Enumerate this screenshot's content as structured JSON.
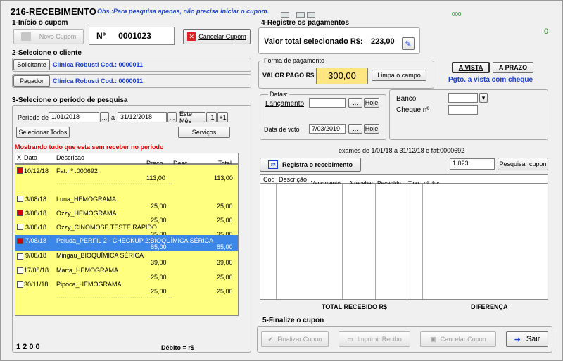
{
  "window": {
    "title": "216-RECEBIMENTO",
    "obs": "Obs.:Para pesquisa apenas, não precisa iniciar o cupom.",
    "top_code": "000",
    "counter": "0"
  },
  "sec1": {
    "title": "1-Início o cupom",
    "novo": "Novo Cupom",
    "n_label": "Nº",
    "cupom_num": "0001023",
    "cancelar": "Cancelar Cupom"
  },
  "sec2": {
    "title": "2-Selecione o cliente",
    "solicitante_btn": "Solicitante",
    "solicitante_val": "Clínica Robusti  Cod.: 0000011",
    "pagador_btn": "Pagador",
    "pagador_val": "Clínica Robusti  Cod.: 0000011"
  },
  "sec3": {
    "title": "3-Selecione o período de pesquisa",
    "periodo": "Período de",
    "de": "1/01/2018",
    "a": "a",
    "ate": "31/12/2018",
    "dots": "...",
    "este_mes": "Este Mês",
    "minus": "-1",
    "plus": "+1",
    "sel_todos": "Selecionar Todos",
    "servicos": "Serviços",
    "warning": "Mostrando tudo que esta sem receber no período"
  },
  "grid": {
    "headers": {
      "x": "X",
      "data": "Data",
      "descricao": "Descricao",
      "preco": "Preco",
      "desc": "Desc",
      "total": "Total"
    },
    "rows": [
      {
        "checked": true,
        "date": "10/12/18",
        "desc": "Fat.nº :000692",
        "preco": "113,00",
        "total": "113,00",
        "sel": false
      },
      {
        "checked": false,
        "date": "3/08/18",
        "desc": "Luna_HEMOGRAMA",
        "preco": "25,00",
        "total": "25,00",
        "sel": false
      },
      {
        "checked": true,
        "date": "3/08/18",
        "desc": "Ozzy_HEMOGRAMA",
        "preco": "25,00",
        "total": "25,00",
        "sel": false
      },
      {
        "checked": false,
        "date": "3/08/18",
        "desc": "Ozzy_CINOMOSE TESTE RÁPIDO",
        "preco": "35,00",
        "total": "35,00",
        "sel": false
      },
      {
        "checked": true,
        "date": "7/08/18",
        "desc": "Peluda_PERFIL 2 - CHECKUP 2:BIOQUÍMICA SÉRICA",
        "preco": "85,00",
        "total": "85,00",
        "sel": true
      },
      {
        "checked": false,
        "date": "9/08/18",
        "desc": "Mingau_BIOQUÍMICA SÉRICA",
        "preco": "39,00",
        "total": "39,00",
        "sel": false
      },
      {
        "checked": false,
        "date": "17/08/18",
        "desc": "Marta_HEMOGRAMA",
        "preco": "25,00",
        "total": "25,00",
        "sel": false
      },
      {
        "checked": false,
        "date": "30/11/18",
        "desc": "Pipoca_HEMOGRAMA",
        "preco": "25,00",
        "total": "25,00",
        "sel": false
      }
    ],
    "dashes": "-------------------------------------------------------",
    "footer_count": "1 2 0 0",
    "debito": "Débito = r$"
  },
  "sec4": {
    "title": "4-Registre os pagamentos",
    "valor_total_label": "Valor total selecionado R$:",
    "valor_total": "223,00",
    "forma": "Forma de pagamento",
    "valor_pago_label": "VALOR PAGO R$",
    "valor_pago": "300,00",
    "limpa": "Limpa o campo",
    "a_vista": "A VISTA",
    "a_prazo": "A PRAZO",
    "pgto": "Pgto. a vista com cheque",
    "datas": "Datas:",
    "lancamento": "Lançamento",
    "hoje": "Hoje",
    "data_vcto": "Data de vcto",
    "vcto": "7/03/2019",
    "banco": "Banco",
    "cheque": "Cheque nº",
    "exames": "exames  de   1/01/18 a 31/12/18 e fat:0000692",
    "registra": "Registra o recebimento",
    "search_val": "1,023",
    "pesquisar": "Pesquisar cupon",
    "pay_headers": {
      "cod": "Cod",
      "desc": "Descrição",
      "venc": "Vencimento",
      "areceber": "A receber",
      "recebido": "Recebido",
      "tipo": "Tipo",
      "ndoc": "nº doc"
    },
    "total_recebido": "TOTAL RECEBIDO R$",
    "diferenca": "DIFERENÇA"
  },
  "sec5": {
    "title": "5-Finalize o cupon",
    "finalizar": "Finalizar Cupon",
    "imprimir": "Imprimir Recibo",
    "cancelar": "Cancelar Cupon",
    "sair": "Sair"
  },
  "colors": {
    "grid_bg": "#ffff80",
    "accent_blue": "#1b3fd0",
    "warning_red": "#e00000",
    "selected_row": "#3c86e8",
    "valor_pago_bg": "#ffe680"
  }
}
